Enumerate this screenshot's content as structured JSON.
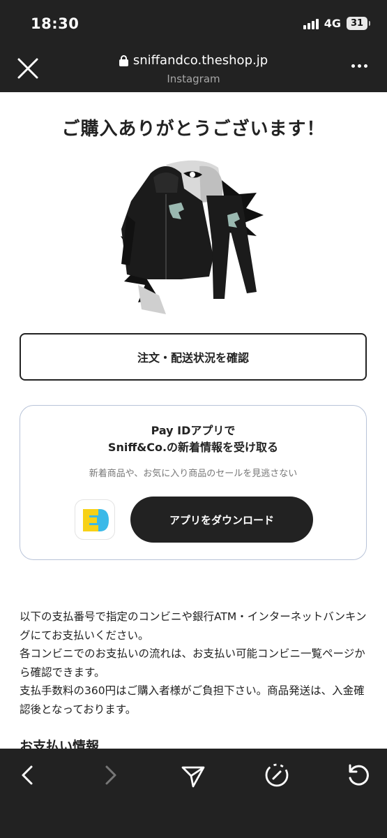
{
  "status": {
    "time": "18:30",
    "network": "4G",
    "battery": "31"
  },
  "browser": {
    "url": "sniffandco.theshop.jp",
    "source": "Instagram"
  },
  "page": {
    "heading": "ご購入ありがとうございます！",
    "order_button": "注文・配送状況を確認",
    "payid": {
      "title_line1": "Pay IDアプリで",
      "title_line2": "Sniff&Co.の新着情報を受け取る",
      "description": "新着商品や、お気に入り商品のセールを見逃さない",
      "download_button": "アプリをダウンロード"
    },
    "info_paragraph1": "以下の支払番号で指定のコンビニや銀行ATM・インターネットバンキングにてお支払いください。",
    "info_paragraph2": "各コンビニでのお支払いの流れは、お支払い可能コンビニ一覧ページから確認できます。",
    "info_paragraph3": "支払手数料の360円はご購入者様がご負担下さい。商品発送は、入金確認後となっております。",
    "payment_info_heading": "お支払い情報"
  },
  "colors": {
    "chrome": "#222222",
    "page_bg": "#ffffff",
    "card_border": "#b8c3d8",
    "payid_yellow": "#f7d117",
    "payid_blue": "#3ab9e8"
  },
  "icons": {
    "close": "close-icon",
    "lock": "lock-icon",
    "more": "more-icon",
    "back": "chevron-left-icon",
    "forward": "chevron-right-icon",
    "share": "send-icon",
    "compass": "compass-icon",
    "reload": "reload-icon"
  }
}
